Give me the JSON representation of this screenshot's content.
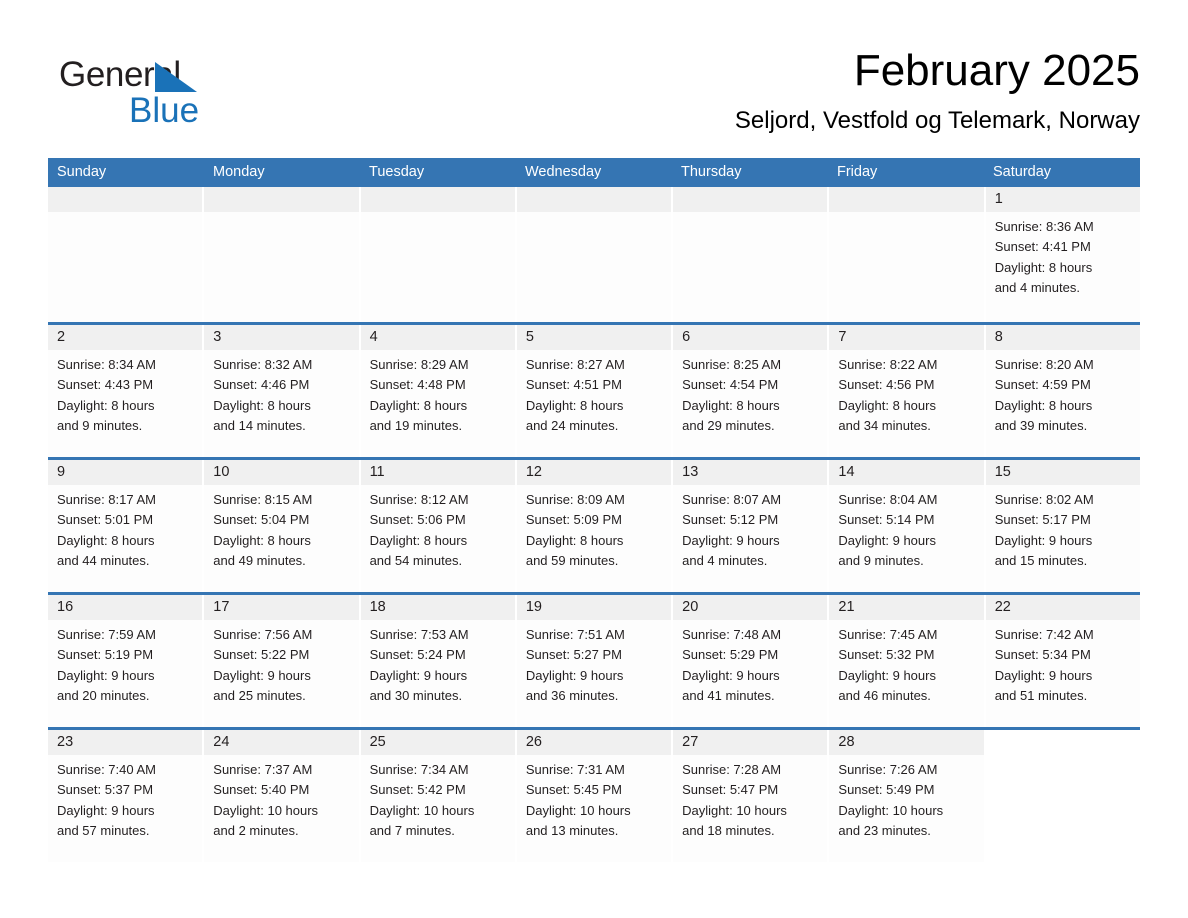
{
  "brand": {
    "name_part1": "General",
    "name_part2": "Blue",
    "accent_color": "#1a72b8"
  },
  "header": {
    "title": "February 2025",
    "subtitle": "Seljord, Vestfold og Telemark, Norway",
    "header_bg_color": "#3575b3"
  },
  "weekday_headers": [
    "Sunday",
    "Monday",
    "Tuesday",
    "Wednesday",
    "Thursday",
    "Friday",
    "Saturday"
  ],
  "weeks": [
    [
      {
        "day": "",
        "blank": true
      },
      {
        "day": "",
        "blank": true
      },
      {
        "day": "",
        "blank": true
      },
      {
        "day": "",
        "blank": true
      },
      {
        "day": "",
        "blank": true
      },
      {
        "day": "",
        "blank": true
      },
      {
        "day": "1",
        "sunrise": "Sunrise: 8:36 AM",
        "sunset": "Sunset: 4:41 PM",
        "daylight1": "Daylight: 8 hours",
        "daylight2": "and 4 minutes."
      }
    ],
    [
      {
        "day": "2",
        "sunrise": "Sunrise: 8:34 AM",
        "sunset": "Sunset: 4:43 PM",
        "daylight1": "Daylight: 8 hours",
        "daylight2": "and 9 minutes."
      },
      {
        "day": "3",
        "sunrise": "Sunrise: 8:32 AM",
        "sunset": "Sunset: 4:46 PM",
        "daylight1": "Daylight: 8 hours",
        "daylight2": "and 14 minutes."
      },
      {
        "day": "4",
        "sunrise": "Sunrise: 8:29 AM",
        "sunset": "Sunset: 4:48 PM",
        "daylight1": "Daylight: 8 hours",
        "daylight2": "and 19 minutes."
      },
      {
        "day": "5",
        "sunrise": "Sunrise: 8:27 AM",
        "sunset": "Sunset: 4:51 PM",
        "daylight1": "Daylight: 8 hours",
        "daylight2": "and 24 minutes."
      },
      {
        "day": "6",
        "sunrise": "Sunrise: 8:25 AM",
        "sunset": "Sunset: 4:54 PM",
        "daylight1": "Daylight: 8 hours",
        "daylight2": "and 29 minutes."
      },
      {
        "day": "7",
        "sunrise": "Sunrise: 8:22 AM",
        "sunset": "Sunset: 4:56 PM",
        "daylight1": "Daylight: 8 hours",
        "daylight2": "and 34 minutes."
      },
      {
        "day": "8",
        "sunrise": "Sunrise: 8:20 AM",
        "sunset": "Sunset: 4:59 PM",
        "daylight1": "Daylight: 8 hours",
        "daylight2": "and 39 minutes."
      }
    ],
    [
      {
        "day": "9",
        "sunrise": "Sunrise: 8:17 AM",
        "sunset": "Sunset: 5:01 PM",
        "daylight1": "Daylight: 8 hours",
        "daylight2": "and 44 minutes."
      },
      {
        "day": "10",
        "sunrise": "Sunrise: 8:15 AM",
        "sunset": "Sunset: 5:04 PM",
        "daylight1": "Daylight: 8 hours",
        "daylight2": "and 49 minutes."
      },
      {
        "day": "11",
        "sunrise": "Sunrise: 8:12 AM",
        "sunset": "Sunset: 5:06 PM",
        "daylight1": "Daylight: 8 hours",
        "daylight2": "and 54 minutes."
      },
      {
        "day": "12",
        "sunrise": "Sunrise: 8:09 AM",
        "sunset": "Sunset: 5:09 PM",
        "daylight1": "Daylight: 8 hours",
        "daylight2": "and 59 minutes."
      },
      {
        "day": "13",
        "sunrise": "Sunrise: 8:07 AM",
        "sunset": "Sunset: 5:12 PM",
        "daylight1": "Daylight: 9 hours",
        "daylight2": "and 4 minutes."
      },
      {
        "day": "14",
        "sunrise": "Sunrise: 8:04 AM",
        "sunset": "Sunset: 5:14 PM",
        "daylight1": "Daylight: 9 hours",
        "daylight2": "and 9 minutes."
      },
      {
        "day": "15",
        "sunrise": "Sunrise: 8:02 AM",
        "sunset": "Sunset: 5:17 PM",
        "daylight1": "Daylight: 9 hours",
        "daylight2": "and 15 minutes."
      }
    ],
    [
      {
        "day": "16",
        "sunrise": "Sunrise: 7:59 AM",
        "sunset": "Sunset: 5:19 PM",
        "daylight1": "Daylight: 9 hours",
        "daylight2": "and 20 minutes."
      },
      {
        "day": "17",
        "sunrise": "Sunrise: 7:56 AM",
        "sunset": "Sunset: 5:22 PM",
        "daylight1": "Daylight: 9 hours",
        "daylight2": "and 25 minutes."
      },
      {
        "day": "18",
        "sunrise": "Sunrise: 7:53 AM",
        "sunset": "Sunset: 5:24 PM",
        "daylight1": "Daylight: 9 hours",
        "daylight2": "and 30 minutes."
      },
      {
        "day": "19",
        "sunrise": "Sunrise: 7:51 AM",
        "sunset": "Sunset: 5:27 PM",
        "daylight1": "Daylight: 9 hours",
        "daylight2": "and 36 minutes."
      },
      {
        "day": "20",
        "sunrise": "Sunrise: 7:48 AM",
        "sunset": "Sunset: 5:29 PM",
        "daylight1": "Daylight: 9 hours",
        "daylight2": "and 41 minutes."
      },
      {
        "day": "21",
        "sunrise": "Sunrise: 7:45 AM",
        "sunset": "Sunset: 5:32 PM",
        "daylight1": "Daylight: 9 hours",
        "daylight2": "and 46 minutes."
      },
      {
        "day": "22",
        "sunrise": "Sunrise: 7:42 AM",
        "sunset": "Sunset: 5:34 PM",
        "daylight1": "Daylight: 9 hours",
        "daylight2": "and 51 minutes."
      }
    ],
    [
      {
        "day": "23",
        "sunrise": "Sunrise: 7:40 AM",
        "sunset": "Sunset: 5:37 PM",
        "daylight1": "Daylight: 9 hours",
        "daylight2": "and 57 minutes."
      },
      {
        "day": "24",
        "sunrise": "Sunrise: 7:37 AM",
        "sunset": "Sunset: 5:40 PM",
        "daylight1": "Daylight: 10 hours",
        "daylight2": "and 2 minutes."
      },
      {
        "day": "25",
        "sunrise": "Sunrise: 7:34 AM",
        "sunset": "Sunset: 5:42 PM",
        "daylight1": "Daylight: 10 hours",
        "daylight2": "and 7 minutes."
      },
      {
        "day": "26",
        "sunrise": "Sunrise: 7:31 AM",
        "sunset": "Sunset: 5:45 PM",
        "daylight1": "Daylight: 10 hours",
        "daylight2": "and 13 minutes."
      },
      {
        "day": "27",
        "sunrise": "Sunrise: 7:28 AM",
        "sunset": "Sunset: 5:47 PM",
        "daylight1": "Daylight: 10 hours",
        "daylight2": "and 18 minutes."
      },
      {
        "day": "28",
        "sunrise": "Sunrise: 7:26 AM",
        "sunset": "Sunset: 5:49 PM",
        "daylight1": "Daylight: 10 hours",
        "daylight2": "and 23 minutes."
      },
      {
        "day": "",
        "nodate": true
      }
    ]
  ]
}
